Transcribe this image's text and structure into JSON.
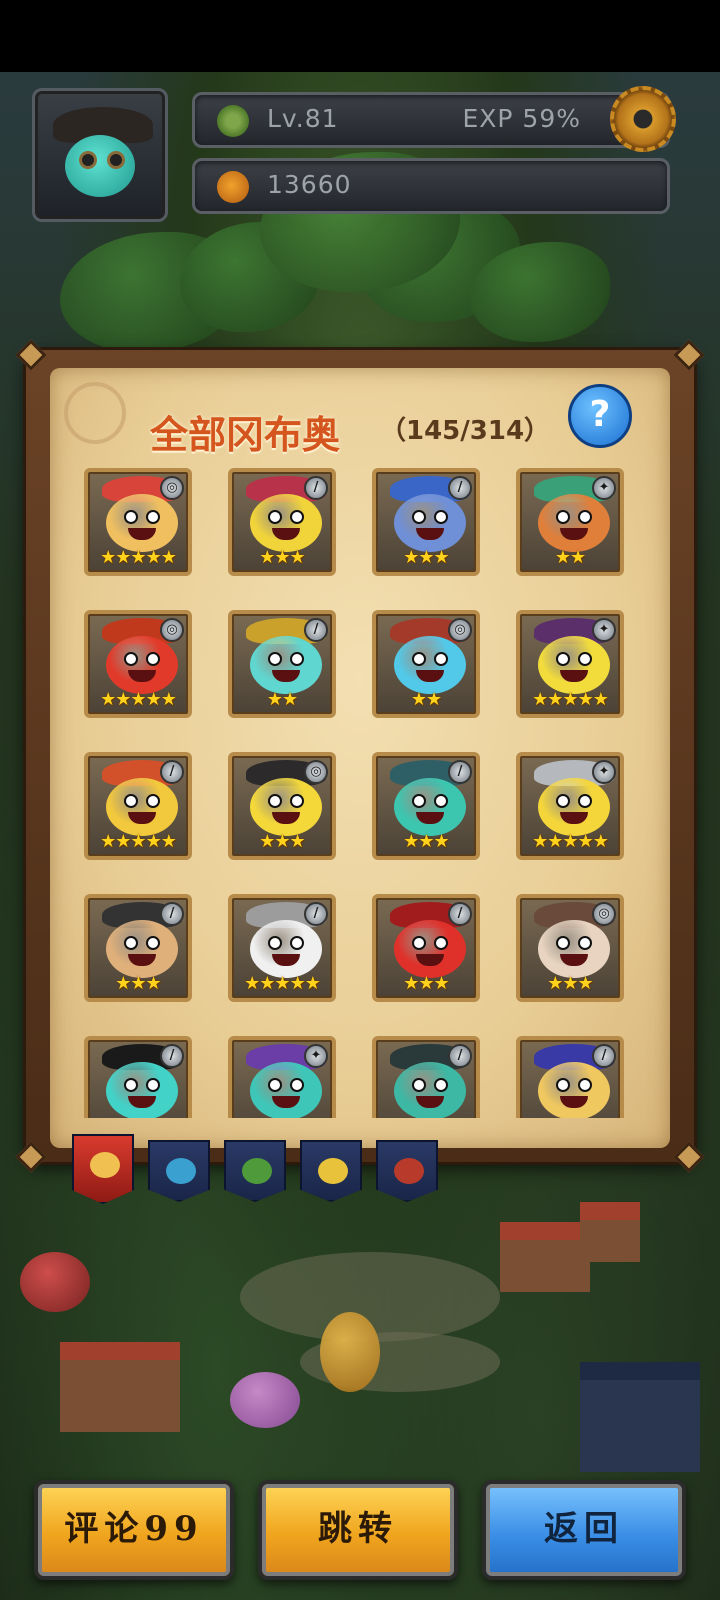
{
  "player": {
    "level": "Lv.81",
    "exp": "EXP 59%",
    "currency": "13660"
  },
  "panel": {
    "title": "全部冈布奥",
    "count": "（145/314）",
    "help": "?"
  },
  "cards": [
    {
      "stars": "★★★★★",
      "element": "water",
      "color": "#f0c060",
      "hat": "#d8443a"
    },
    {
      "stars": "★★★",
      "element": "blade",
      "color": "#f1d33a",
      "hat": "#b8324a"
    },
    {
      "stars": "★★★",
      "element": "blade",
      "color": "#6f8fd6",
      "hat": "#3a66c8"
    },
    {
      "stars": "★★",
      "element": "fire",
      "color": "#e07f3a",
      "hat": "#3aa078"
    },
    {
      "stars": "★★★★★",
      "element": "water",
      "color": "#e23a2a",
      "hat": "#c0391c"
    },
    {
      "stars": "★★",
      "element": "blade",
      "color": "#5fd7d0",
      "hat": "#c9a12b"
    },
    {
      "stars": "★★",
      "element": "water",
      "color": "#52c9e8",
      "hat": "#a43a2a"
    },
    {
      "stars": "★★★★★",
      "element": "fire",
      "color": "#f2dc3c",
      "hat": "#5a2f6a"
    },
    {
      "stars": "★★★★★",
      "element": "blade",
      "color": "#f2c83c",
      "hat": "#d2502a"
    },
    {
      "stars": "★★★",
      "element": "water",
      "color": "#f4d83a",
      "hat": "#2c2a2a"
    },
    {
      "stars": "★★★",
      "element": "blade",
      "color": "#3cc6b0",
      "hat": "#2f5f66"
    },
    {
      "stars": "★★★★★",
      "element": "fire",
      "color": "#f4d63a",
      "hat": "#b5b8bc"
    },
    {
      "stars": "★★★",
      "element": "blade",
      "color": "#e0b07a",
      "hat": "#333333"
    },
    {
      "stars": "★★★★★",
      "element": "blade",
      "color": "#f0f0f0",
      "hat": "#9c9c9c"
    },
    {
      "stars": "★★★",
      "element": "blade",
      "color": "#e0302a",
      "hat": "#a11c1c"
    },
    {
      "stars": "★★★",
      "element": "water",
      "color": "#e8d4c0",
      "hat": "#6a4a3a"
    },
    {
      "stars": "",
      "element": "blade",
      "color": "#42d2c8",
      "hat": "#1a1a1a"
    },
    {
      "stars": "",
      "element": "fire",
      "color": "#3ec7b8",
      "hat": "#6a3ea6"
    },
    {
      "stars": "",
      "element": "blade",
      "color": "#3cb8a4",
      "hat": "#2a3a3a"
    },
    {
      "stars": "",
      "element": "blade",
      "color": "#f0c860",
      "hat": "#3a3aa6"
    }
  ],
  "tabs": [
    {
      "name": "all",
      "color": "#f0c050"
    },
    {
      "name": "water",
      "color": "#3aa0d0"
    },
    {
      "name": "nature",
      "color": "#4f9a3a"
    },
    {
      "name": "light",
      "color": "#e8c23a"
    },
    {
      "name": "dark",
      "color": "#b83a2a"
    }
  ],
  "buttons": {
    "comment": "评论99",
    "jump": "跳转",
    "back": "返回"
  },
  "colors": {
    "title": "#d4551e",
    "gold_button": "#f0a51e",
    "blue_button": "#3b8fe6",
    "star": "#ffd21c"
  }
}
